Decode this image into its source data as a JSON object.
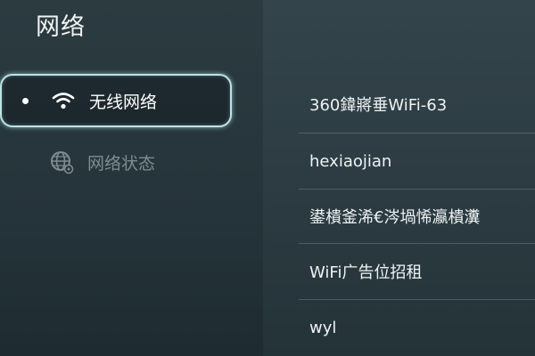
{
  "header": {
    "title": "网络"
  },
  "menu": {
    "items": [
      {
        "label": "无线网络",
        "icon": "wifi-icon",
        "selected": true
      },
      {
        "label": "网络状态",
        "icon": "globe-icon",
        "selected": false
      }
    ]
  },
  "networks": [
    {
      "name": "360鍏嶈垂WiFi-63"
    },
    {
      "name": "hexiaojian"
    },
    {
      "name": "鍙樻釜浠€涔堝悕瀛樻瀵"
    },
    {
      "name": "WiFi广告位招租"
    },
    {
      "name": "wyl"
    }
  ],
  "colors": {
    "selection_border": "#bfe3e6",
    "text_primary": "#ffffff",
    "text_dim": "#7e8c90"
  }
}
